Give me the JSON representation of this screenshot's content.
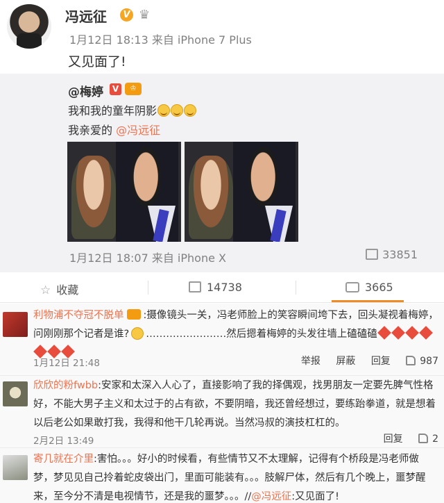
{
  "post": {
    "username": "冯远征",
    "verified_badge": "V",
    "date": "1月12日",
    "time": "18:13",
    "source": "来自 iPhone 7 Plus",
    "text": "又见面了!"
  },
  "repost": {
    "username": "@梅婷",
    "verified_badge": "V",
    "line1": "我和我的童年阴影",
    "line2_prefix": "我亲爱的 ",
    "line2_mention": "@冯远征",
    "date": "1月12日",
    "time": "18:07",
    "source": "来自 iPhone X",
    "share_count": "33851"
  },
  "actions": {
    "favorite_label": "收藏",
    "repost_count": "14738",
    "comment_count": "3665"
  },
  "comments": [
    {
      "name": "利物浦不夺冠不脱单",
      "text_a": ":摄像镜头一关，冯老师脸上的笑容瞬间垮下去，回头凝视着梅婷，问刚刚那个记者是谁?",
      "text_b": "……………………然后摁着梅婷的头发往墙上磕磕磕",
      "time": "1月12日 21:48",
      "report": "举报",
      "block": "屏蔽",
      "reply": "回复",
      "likes": "987"
    },
    {
      "name": "欣欣的粉fwbb",
      "text": ":安家和太深入人心了，直接影响了我的择偶观，找男朋友一定要先脾气性格好，不能大男子主义和太过于的占有欲，不要阴暗，我还曾经想过，要练跆拳道，就是想着以后老公如果敢打我，我得和他干几轮再说。当然冯叔的演技杠杠的。",
      "time": "2月2日 13:49",
      "reply": "回复",
      "likes": "2"
    },
    {
      "name": "寄几就在介里",
      "text": ":害怕。。。好小的时候看，有些情节又不太理解，记得有个桥段是冯老师做梦，梦见见自己拎着蛇皮袋出门，里面可能装有。。。肢解尸体，然后有几个晚上，噩梦醒来，至今分不清是电视情节，还是我的噩梦。。。//",
      "mention": "@冯远征",
      "text_end": ":又见面了!"
    }
  ]
}
